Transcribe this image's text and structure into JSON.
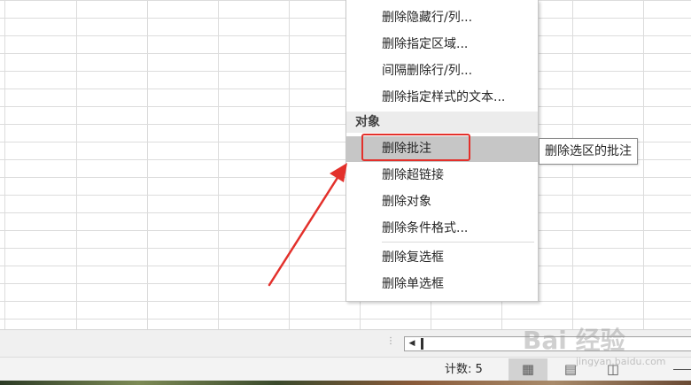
{
  "menu": {
    "items_top": [
      "删除隐藏行/列...",
      "删除指定区域...",
      "间隔删除行/列...",
      "删除指定样式的文本..."
    ],
    "section_label": "对象",
    "items_obj": [
      "删除批注",
      "删除超链接",
      "删除对象",
      "删除条件格式..."
    ],
    "items_bottom": [
      "删除复选框",
      "删除单选框"
    ],
    "highlighted": "删除批注"
  },
  "tooltip": {
    "text": "删除选区的批注"
  },
  "annotation": {
    "highlight_color": "#e3302b",
    "arrow_color": "#e3302b"
  },
  "status_bar": {
    "count": "计数: 5",
    "view_buttons": [
      "normal-view",
      "page-layout-view",
      "page-break-view"
    ]
  },
  "watermark": {
    "text": "Bai 经验",
    "subtext": "jingyan.baidu.com"
  }
}
